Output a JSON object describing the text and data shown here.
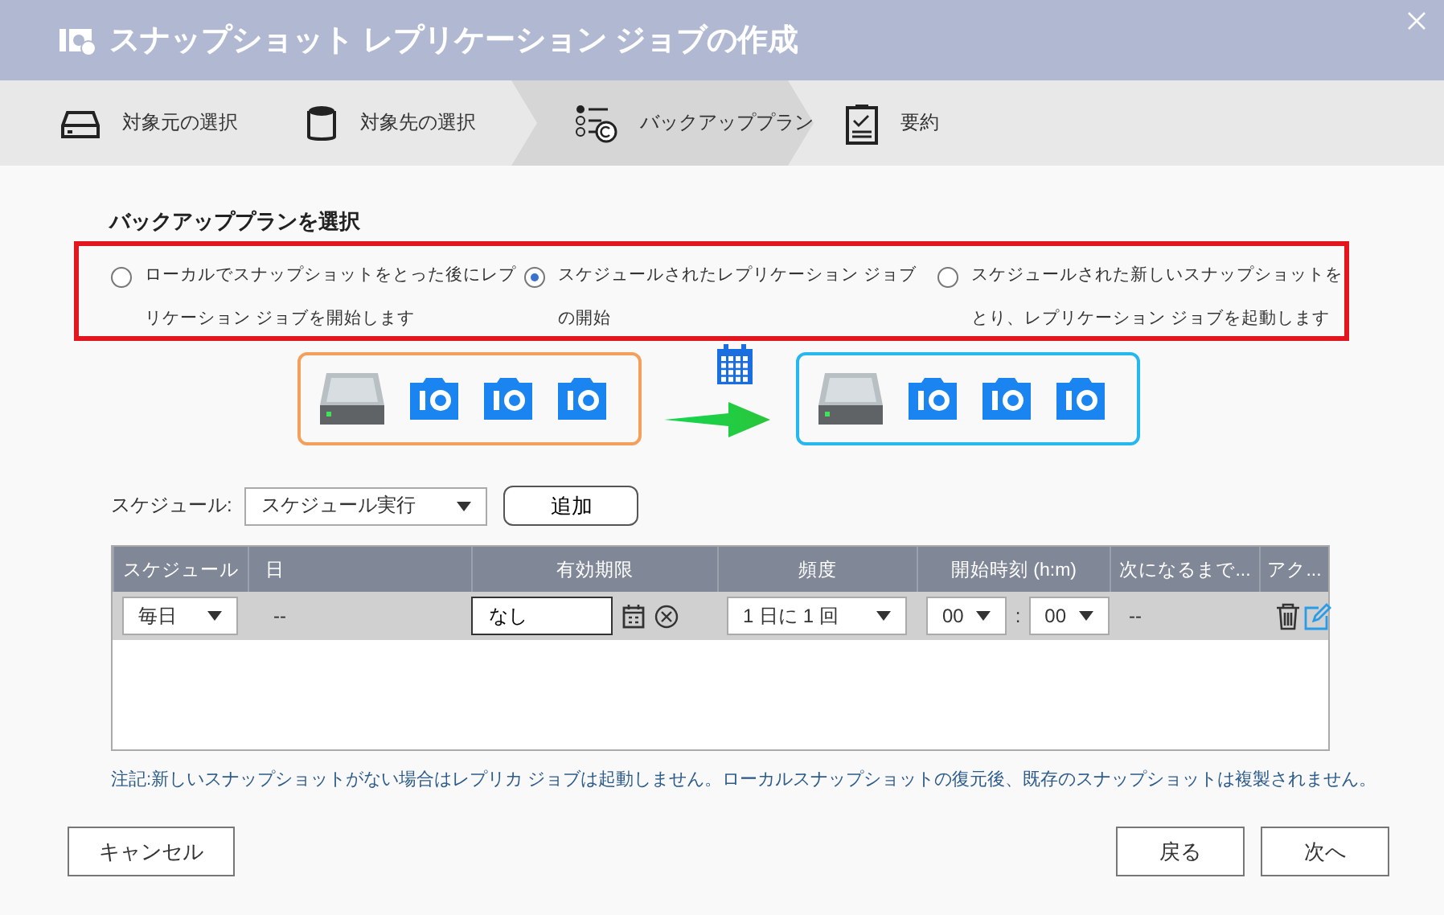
{
  "window": {
    "title": "スナップショット レプリケーション ジョブの作成"
  },
  "steps": [
    {
      "label": "対象元の選択",
      "selected": false
    },
    {
      "label": "対象先の選択",
      "selected": false
    },
    {
      "label": "バックアッププラン",
      "selected": true
    },
    {
      "label": "要約",
      "selected": false
    }
  ],
  "plan": {
    "heading": "バックアッププランを選択",
    "options": [
      {
        "label": "ローカルでスナップショットをとった後にレプリケーション ジョブを開始します",
        "selected": false
      },
      {
        "label": "スケジュールされたレプリケーション ジョブの開始",
        "selected": true
      },
      {
        "label": "スケジュールされた新しいスナップショットをとり、レプリケーション ジョブを起動します",
        "selected": false
      }
    ]
  },
  "schedule": {
    "label": "スケジュール:",
    "value": "スケジュール実行",
    "add_button": "追加"
  },
  "table": {
    "columns": [
      "スケジュール",
      "日",
      "有効期限",
      "頻度",
      "開始時刻 (h:m)",
      "次になるまで...",
      "アク..."
    ],
    "rows": [
      {
        "schedule": "毎日",
        "day": "--",
        "expiry": "なし",
        "frequency": "1 日に 1 回",
        "hour": "00",
        "separator": ":",
        "minute": "00",
        "next": "--"
      }
    ]
  },
  "note": "注記:新しいスナップショットがない場合はレプリカ ジョブは起動しません。ローカルスナップショットの復元後、既存のスナップショットは複製されません。",
  "buttons": {
    "cancel": "キャンセル",
    "back": "戻る",
    "next": "次へ"
  }
}
